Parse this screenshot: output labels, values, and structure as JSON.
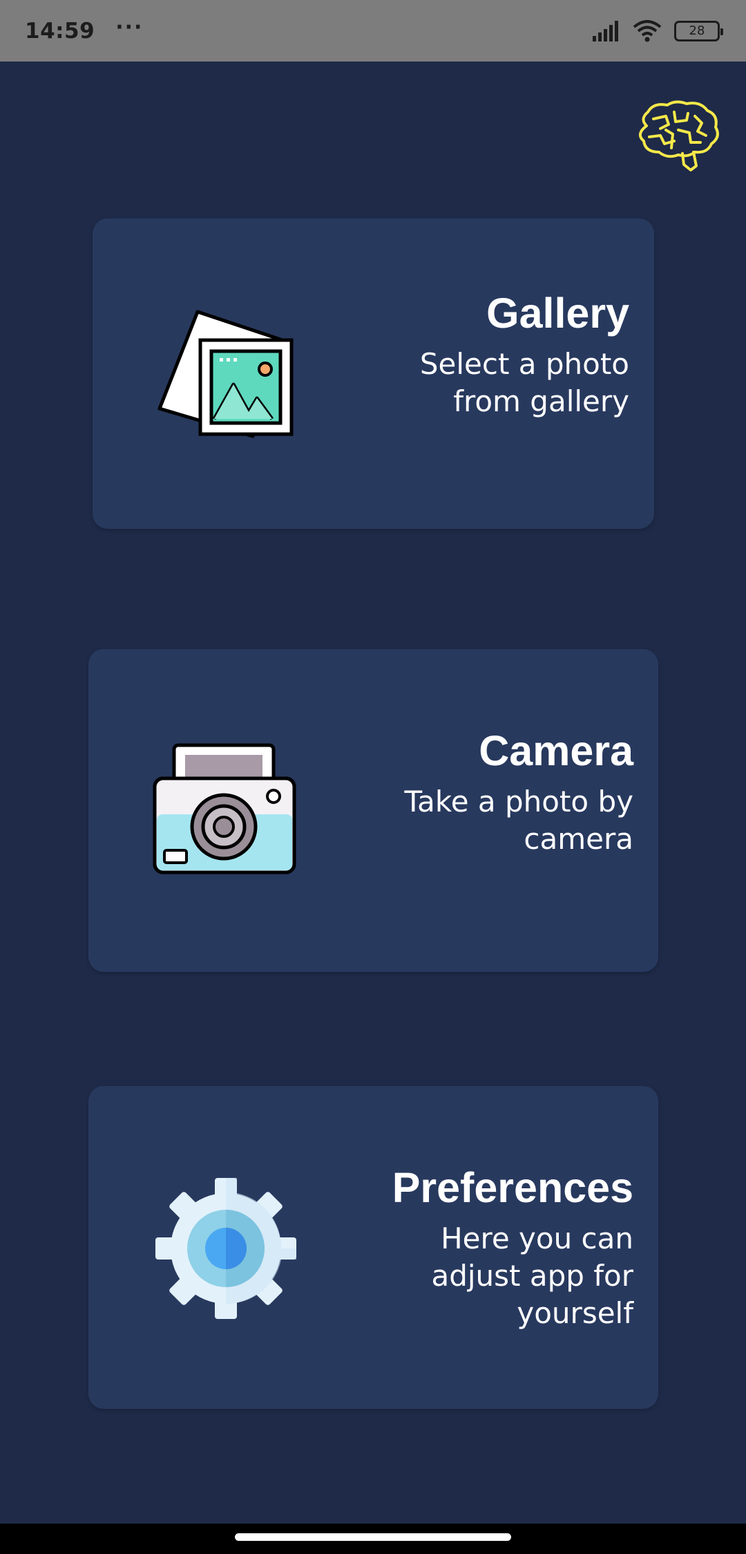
{
  "status_bar": {
    "time": "14:59",
    "overflow": "···",
    "battery": "28",
    "icons": [
      "signal-icon",
      "wifi-icon",
      "battery-icon"
    ]
  },
  "header": {
    "logo_icon": "brain-icon",
    "logo_color": "#f5e84a"
  },
  "menu": {
    "gallery": {
      "title": "Gallery",
      "description": "Select a photo\nfrom gallery",
      "icon": "gallery-icon"
    },
    "camera": {
      "title": "Camera",
      "description": "Take a photo by\ncamera",
      "icon": "camera-icon"
    },
    "preferences": {
      "title": "Preferences",
      "description": "Here you can\nadjust app for\nyourself",
      "icon": "gear-icon"
    }
  },
  "colors": {
    "background": "#1e2a48",
    "card": "#28395e",
    "text": "#ffffff"
  }
}
